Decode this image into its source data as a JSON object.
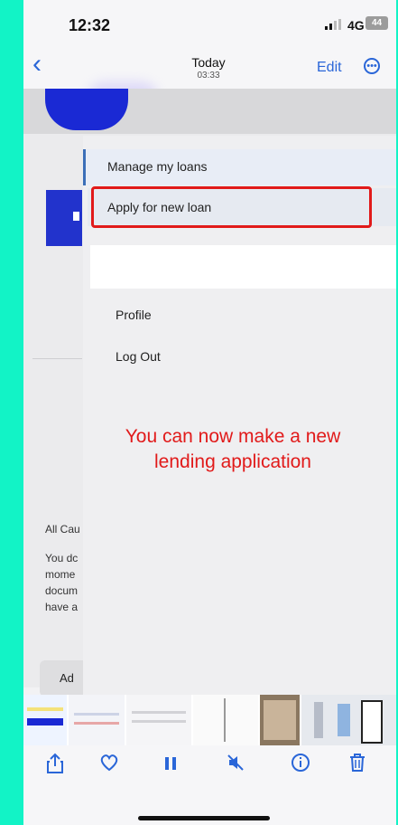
{
  "status_bar": {
    "time": "12:32",
    "network": "4G",
    "battery": "44"
  },
  "nav": {
    "back_icon": "chevron-left-icon",
    "title": "Today",
    "subtitle": "03:33",
    "edit": "Edit",
    "more_icon": "ellipsis-circle-icon"
  },
  "menu": {
    "items": [
      {
        "label": "Manage my loans",
        "state": "active"
      },
      {
        "label": "Apply for new loan",
        "state": "highlighted"
      },
      {
        "label": "Profile"
      },
      {
        "label": "Log Out"
      }
    ]
  },
  "annotation": {
    "text": "You can now make a new lending application",
    "color": "#e11a1a"
  },
  "background_page": {
    "lines": [
      "All Cau",
      "You dc",
      "mome",
      "docum",
      "have a"
    ],
    "card_label": "Ad"
  },
  "toolbar": {
    "share": "share-icon",
    "favorite": "heart-icon",
    "pause": "pause-icon",
    "mute": "mute-icon",
    "info": "info-icon",
    "delete": "trash-icon"
  },
  "colors": {
    "accent": "#2a66d8",
    "brand": "#1a29d4",
    "highlight": "#e11a1a",
    "frame": "#12f3c6"
  }
}
